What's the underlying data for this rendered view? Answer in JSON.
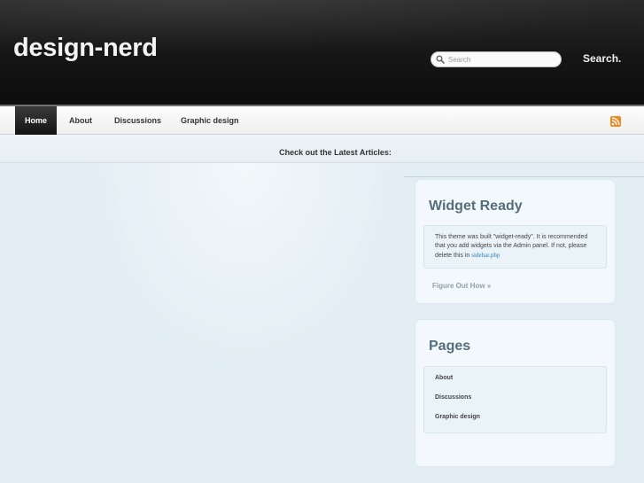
{
  "header": {
    "site_title": "design-nerd",
    "search": {
      "placeholder": "Search",
      "button_label": "Search."
    }
  },
  "nav": {
    "items": [
      {
        "label": "Home",
        "active": true
      },
      {
        "label": "About",
        "active": false
      },
      {
        "label": "Discussions",
        "active": false
      },
      {
        "label": "Graphic design",
        "active": false
      }
    ],
    "rss_icon": "rss-icon"
  },
  "banner": {
    "text": "Check out the Latest Articles:"
  },
  "sidebar": {
    "widget_ready": {
      "title": "Widget Ready",
      "body_text": "This theme was built \"widget-ready\". It is recommended that you add widgets via the Admin panel. If not, please delete this in",
      "body_link": "sidebar.php",
      "more_link": "Figure Out How »"
    },
    "pages": {
      "title": "Pages",
      "items": [
        "About",
        "Discussions",
        "Graphic design"
      ]
    }
  },
  "colors": {
    "header_bg": "#151515",
    "body_bg": "#e3eef4",
    "widget_title": "#566d7a",
    "link": "#2b7bb5",
    "rss": "#f0891f"
  }
}
